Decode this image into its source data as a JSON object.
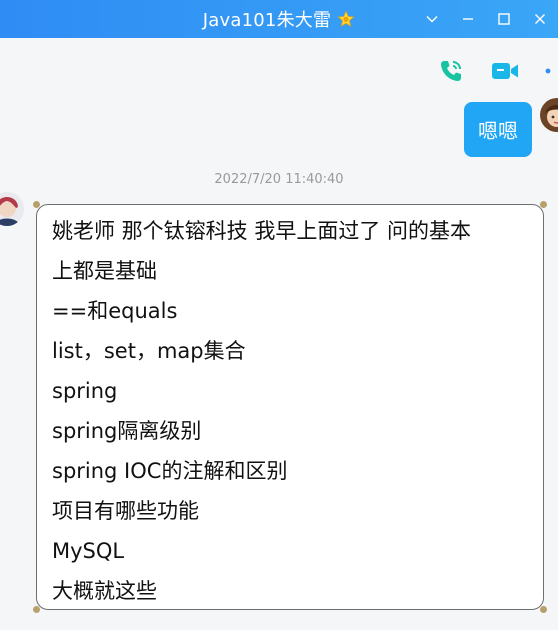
{
  "window": {
    "title": "Java101朱大雷",
    "badge_icon": "crown-star-icon",
    "controls": [
      "chevron-down-icon",
      "minimize-icon",
      "maximize-icon",
      "close-icon"
    ]
  },
  "toolbar": {
    "icons": [
      "phone-call-icon",
      "video-call-icon",
      "more-options-icon"
    ],
    "colors": {
      "phone": "#17c3a0",
      "video": "#18b7e8",
      "more": "#2f8cf4"
    }
  },
  "messages": {
    "outgoing": {
      "text": "嗯嗯"
    },
    "timestamp": "2022/7/20 11:40:40",
    "incoming": {
      "lines": [
        "姚老师 那个钛镕科技 我早上面过了 问的基本",
        "上都是基础",
        "==和equals",
        "list，set，map集合",
        "spring",
        "spring隔离级别",
        "spring IOC的注解和区别",
        "项目有哪些功能",
        "MySQL",
        "大概就这些"
      ]
    }
  },
  "colors": {
    "titlebar": "#2f8cf4",
    "outgoing_bubble": "#20a6f5",
    "background": "#f5f6f8"
  }
}
